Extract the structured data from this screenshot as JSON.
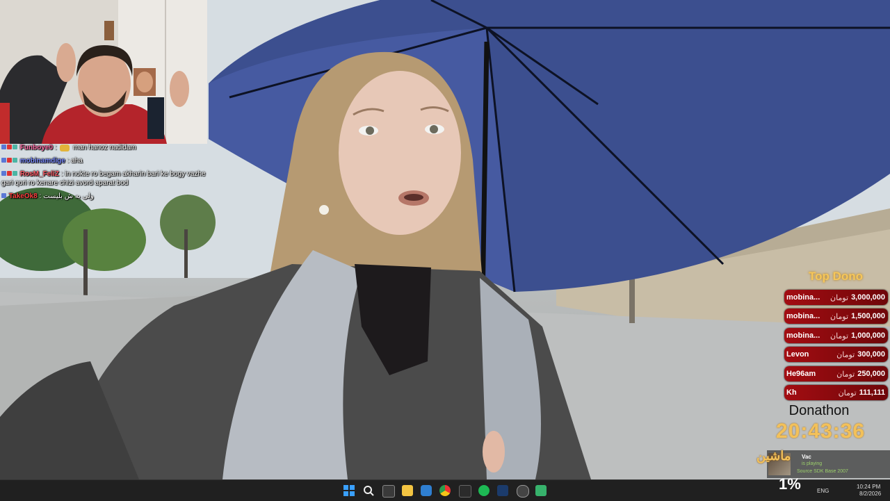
{
  "chat": [
    {
      "user": "Funboye0",
      "color": "#ff6fa8",
      "emote": true,
      "message": "man hanoz nadidam"
    },
    {
      "user": "mobinamdige",
      "color": "#7b8cff",
      "emote": false,
      "message": "aha"
    },
    {
      "user": "RosM_FeliZ",
      "color": "#ff5f6b",
      "emote": false,
      "message": "in nokte ro begam akharin bari ke bogy vazhe gari qori ro kenare chizi avord aparat bod"
    },
    {
      "user": "TakeOk8",
      "color": "#ff4040",
      "emote": false,
      "message": "ولی یه ش بلیست"
    }
  ],
  "top_dono": {
    "title": "Top Dono",
    "currency": "تومان",
    "rows": [
      {
        "name": "mobina...",
        "amount": "3,000,000"
      },
      {
        "name": "mobina...",
        "amount": "1,500,000"
      },
      {
        "name": "mobina...",
        "amount": "1,000,000"
      },
      {
        "name": "Levon",
        "amount": "300,000"
      },
      {
        "name": "He96am",
        "amount": "250,000"
      },
      {
        "name": "Kh",
        "amount": "111,111"
      }
    ]
  },
  "donathon": {
    "title": "Donathon",
    "timer": "20:43:36"
  },
  "now_playing": {
    "arabic": "ماشين",
    "user": "Vac",
    "status": "is playing",
    "game": "Source SDK Base 2007"
  },
  "taskbar": {
    "percent": "1%",
    "lang": "ENG",
    "time": "10:24 PM",
    "date": "8/2/2026",
    "icons": [
      "windows-start-icon",
      "search-icon",
      "task-view-icon",
      "file-explorer-icon",
      "vscode-icon",
      "chrome-icon",
      "epic-games-icon",
      "spotify-icon",
      "steam-icon",
      "app-icon",
      "feather-app-icon"
    ]
  },
  "colors": {
    "dono_row": "#a30d12",
    "accent_gold": "#f3c15a",
    "taskbar": "#202020"
  }
}
